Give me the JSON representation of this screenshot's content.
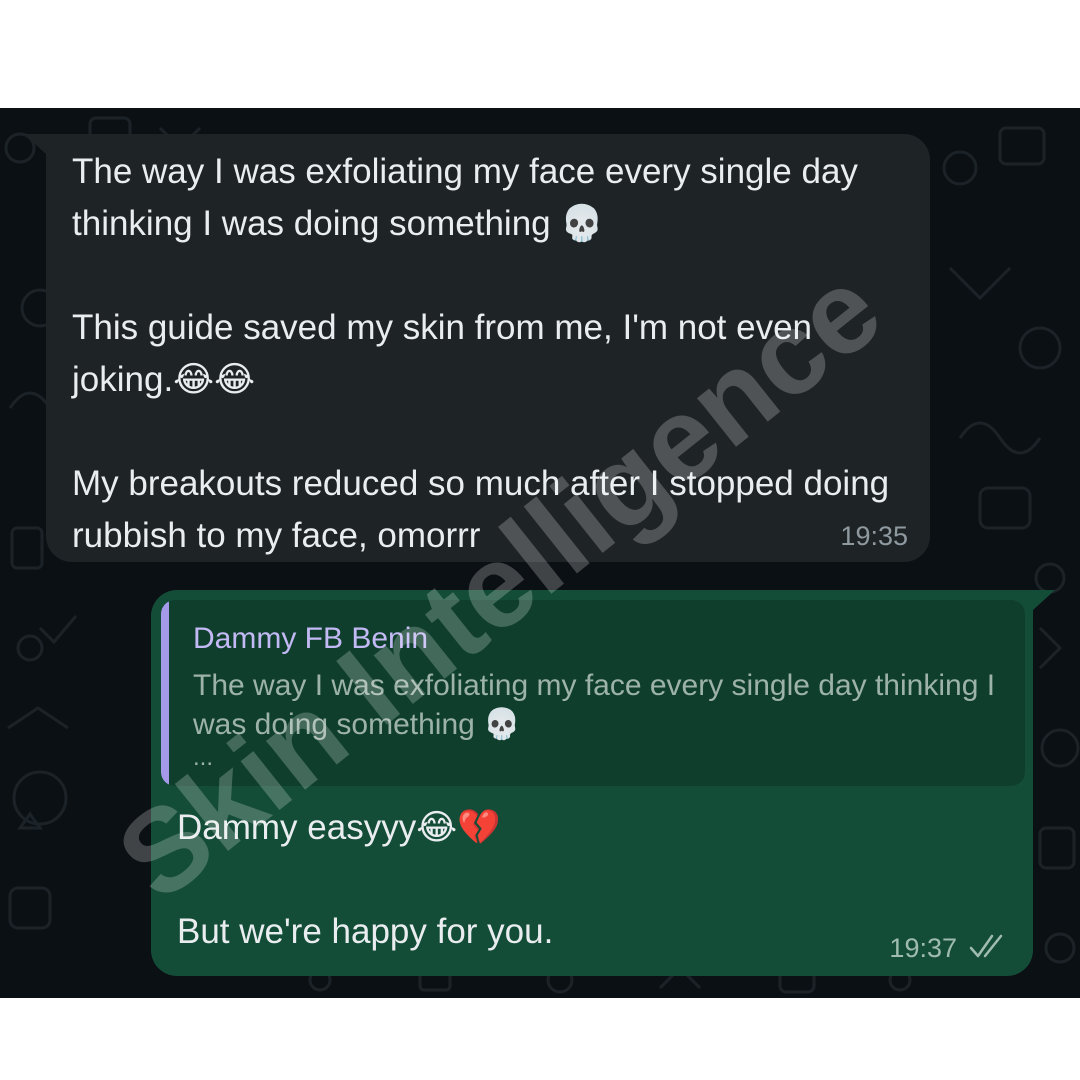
{
  "chat": {
    "incoming": {
      "text": "The way I was exfoliating my face every single day thinking I was doing something 💀\n\nThis guide saved my skin from me, I'm not even joking.😂😂\n\nMy breakouts reduced so much after I stopped doing rubbish to my face, omorrr",
      "time": "19:35"
    },
    "outgoing": {
      "quote": {
        "author": "Dammy FB Benin",
        "text": "The way I was exfoliating my face every single day thinking I was doing something 💀",
        "more": "..."
      },
      "text": "Dammy easyyy😂💔\n\nBut we're happy for you.",
      "time": "19:37",
      "status_icon": "double-check-icon"
    }
  },
  "watermark": {
    "text": "Skin Intelligence"
  },
  "colors": {
    "chat_background": "#0b1014",
    "incoming_bubble": "#1e2326",
    "outgoing_bubble": "#144d37",
    "quote_bar": "#a59ae9"
  }
}
